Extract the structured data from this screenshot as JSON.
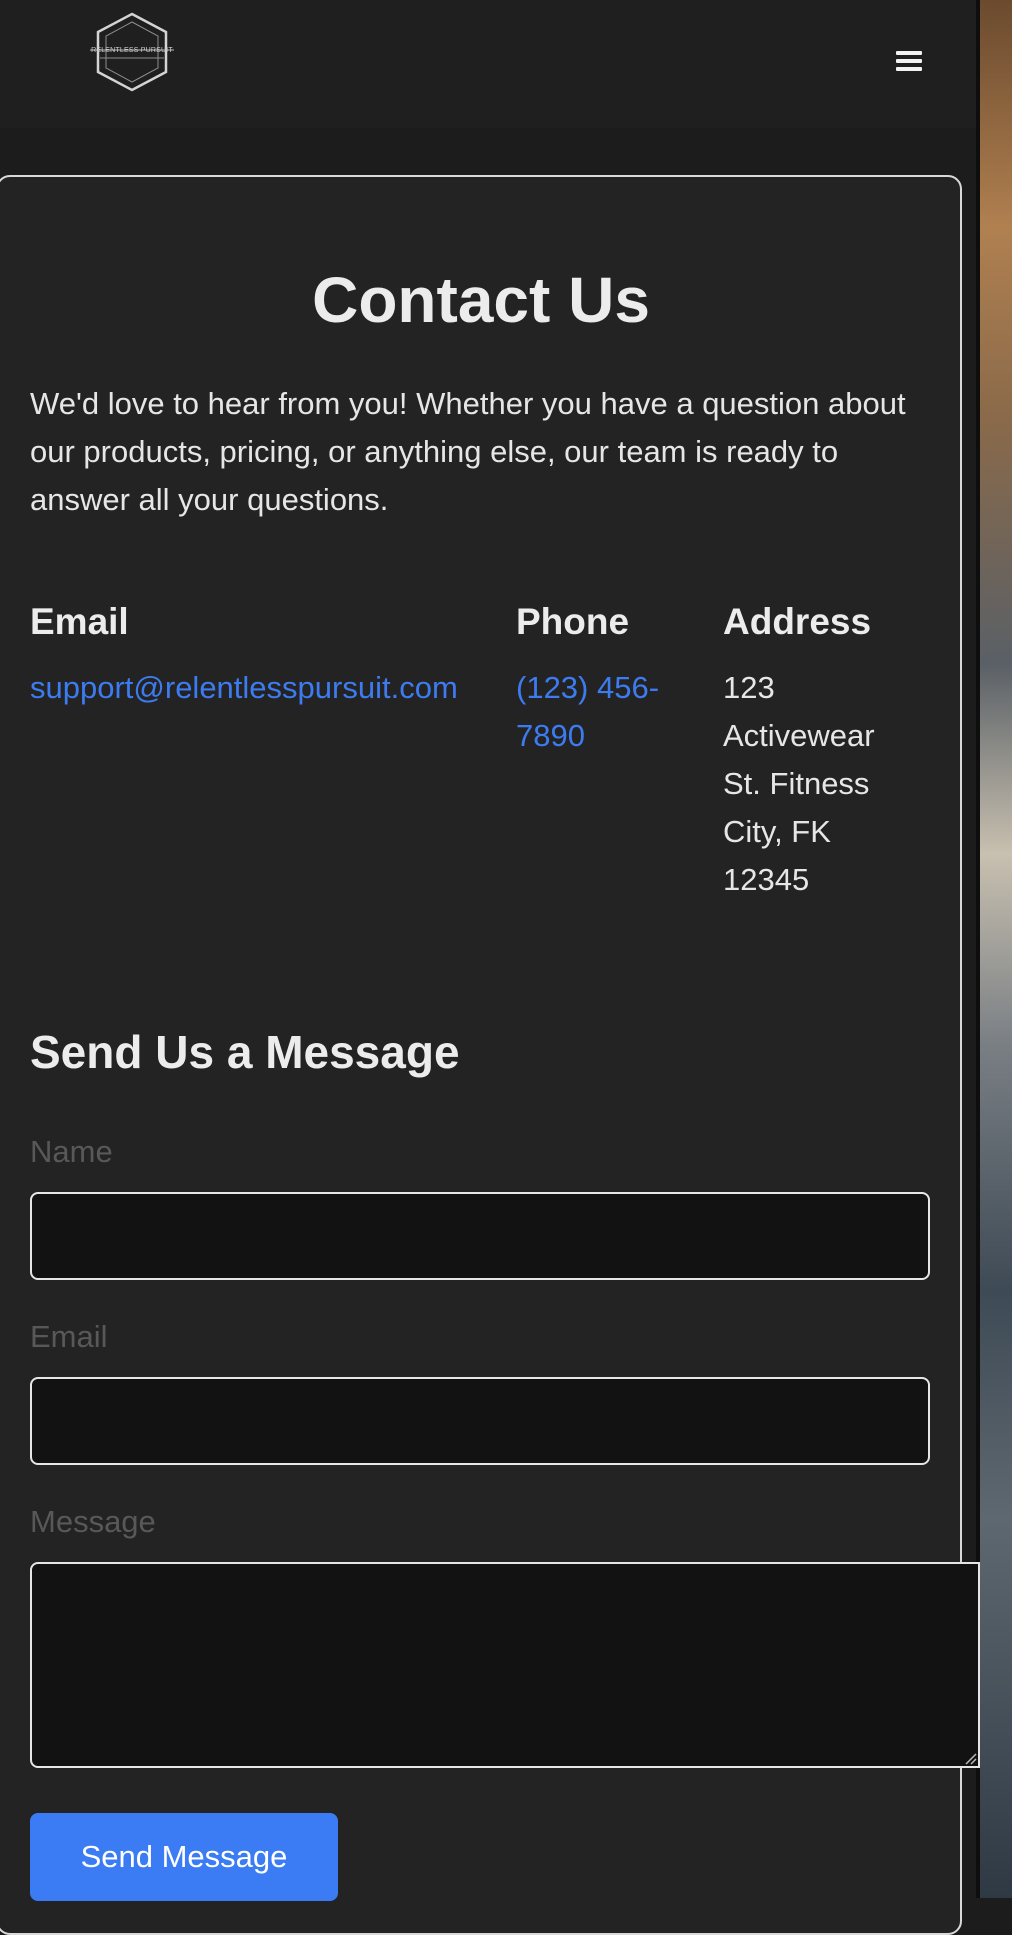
{
  "header": {
    "logo_text": "RELENTLESS PURSUIT",
    "menu_icon": "hamburger-menu-icon"
  },
  "contact": {
    "title": "Contact Us",
    "intro": "We'd love to hear from you! Whether you have a question about our products, pricing, or anything else, our team is ready to answer all your questions.",
    "email": {
      "heading": "Email",
      "value": "support@relentlesspursuit.com"
    },
    "phone": {
      "heading": "Phone",
      "value": "(123) 456-7890"
    },
    "address": {
      "heading": "Address",
      "value": "123 Activewear St. Fitness City, FK 12345"
    }
  },
  "form": {
    "title": "Send Us a Message",
    "name_label": "Name",
    "name_value": "",
    "email_label": "Email",
    "email_value": "",
    "message_label": "Message",
    "message_value": "",
    "submit_label": "Send Message"
  },
  "colors": {
    "page_background": "#1c1c1c",
    "card_background": "#232323",
    "link": "#3d7bf0",
    "button": "#3b7cf5",
    "input_background": "#121212"
  }
}
